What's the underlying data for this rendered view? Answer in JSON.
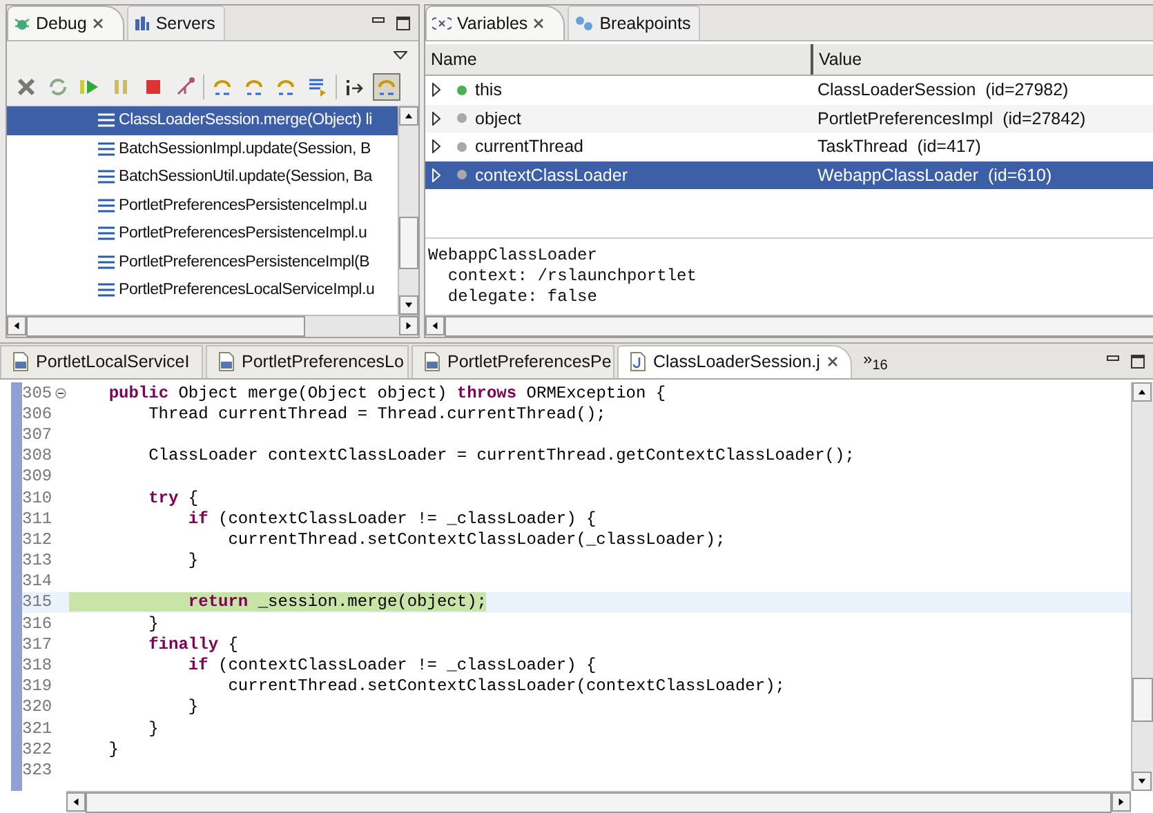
{
  "debug_view": {
    "tabs": [
      {
        "label": "Debug",
        "selected": true,
        "closable": true
      },
      {
        "label": "Servers",
        "selected": false,
        "closable": false
      }
    ],
    "toolbar": [
      {
        "kind": "remove",
        "pressed": false
      },
      {
        "kind": "relaunch",
        "pressed": false
      },
      {
        "kind": "resume",
        "pressed": false
      },
      {
        "kind": "suspend",
        "pressed": false
      },
      {
        "kind": "terminate",
        "pressed": false
      },
      {
        "kind": "disconnect",
        "pressed": false
      },
      {
        "kind": "separator"
      },
      {
        "kind": "step-into",
        "pressed": false
      },
      {
        "kind": "step-over",
        "pressed": false
      },
      {
        "kind": "step-return",
        "pressed": false
      },
      {
        "kind": "drop-frame",
        "pressed": false
      },
      {
        "kind": "separator"
      },
      {
        "kind": "instruction",
        "pressed": false
      },
      {
        "kind": "step-filter",
        "pressed": true
      }
    ],
    "frames": [
      {
        "text": "ClassLoaderSession.merge(Object) li",
        "selected": true
      },
      {
        "text": "BatchSessionImpl.update(Session, B",
        "selected": false
      },
      {
        "text": "BatchSessionUtil.update(Session, Ba",
        "selected": false
      },
      {
        "text": "PortletPreferencesPersistenceImpl.u",
        "selected": false
      },
      {
        "text": "PortletPreferencesPersistenceImpl.u",
        "selected": false
      },
      {
        "text": "PortletPreferencesPersistenceImpl(B",
        "selected": false
      },
      {
        "text": "PortletPreferencesLocalServiceImpl.u",
        "selected": false
      }
    ]
  },
  "variables_view": {
    "tabs": [
      {
        "label": "Variables",
        "selected": true,
        "closable": true
      },
      {
        "label": "Breakpoints",
        "selected": false,
        "closable": false
      }
    ],
    "columns": [
      "Name",
      "Value"
    ],
    "rows": [
      {
        "name": "this",
        "value": "ClassLoaderSession  (id=27982)",
        "color": "#4caf50",
        "selected": false
      },
      {
        "name": "object",
        "value": "PortletPreferencesImpl  (id=27842)",
        "color": "#a8a8a8",
        "selected": false
      },
      {
        "name": "currentThread",
        "value": "TaskThread  (id=417)",
        "color": "#a8a8a8",
        "selected": false
      },
      {
        "name": "contextClassLoader",
        "value": "WebappClassLoader  (id=610)",
        "color": "#a8a8a8",
        "selected": true
      }
    ],
    "detail": [
      "WebappClassLoader",
      "  context: /rslaunchportlet",
      "  delegate: false"
    ]
  },
  "editor": {
    "tabs": [
      {
        "label": "PortletLocalServiceI",
        "selected": false,
        "closable": false
      },
      {
        "label": "PortletPreferencesLo",
        "selected": false,
        "closable": false
      },
      {
        "label": "PortletPreferencesPe",
        "selected": false,
        "closable": false
      },
      {
        "label": "ClassLoaderSession.j",
        "selected": true,
        "closable": true
      }
    ],
    "overflow": {
      "symbol": "»",
      "count": "16"
    },
    "lines": [
      {
        "number": "305",
        "text": "    **public** Object merge(Object object) **throws** ORMException {",
        "current": false,
        "fold": true
      },
      {
        "number": "306",
        "text": "        Thread currentThread = Thread.currentThread();",
        "current": false,
        "fold": false
      },
      {
        "number": "307",
        "current": false,
        "fold": false
      },
      {
        "number": "308",
        "text": "        ClassLoader contextClassLoader = currentThread.getContextClassLoader();",
        "current": false,
        "fold": false
      },
      {
        "number": "309",
        "current": false,
        "fold": false
      },
      {
        "number": "310",
        "text": "        **try** {",
        "current": false,
        "fold": false
      },
      {
        "number": "311",
        "text": "            **if** (contextClassLoader != _classLoader) {",
        "current": false,
        "fold": false
      },
      {
        "number": "312",
        "text": "                currentThread.setContextClassLoader(_classLoader);",
        "current": false,
        "fold": false
      },
      {
        "number": "313",
        "text": "            }",
        "current": false,
        "fold": false
      },
      {
        "number": "314",
        "current": false,
        "fold": false
      },
      {
        "number": "315",
        "text": "            **return** _session.merge(object);",
        "current": true,
        "fold": false
      },
      {
        "number": "316",
        "text": "        }",
        "current": false,
        "fold": false
      },
      {
        "number": "317",
        "text": "        **finally** {",
        "current": false,
        "fold": false
      },
      {
        "number": "318",
        "text": "            **if** (contextClassLoader != _classLoader) {",
        "current": false,
        "fold": false
      },
      {
        "number": "319",
        "text": "                currentThread.setContextClassLoader(contextClassLoader);",
        "current": false,
        "fold": false
      },
      {
        "number": "320",
        "text": "            }",
        "current": false,
        "fold": false
      },
      {
        "number": "321",
        "text": "        }",
        "current": false,
        "fold": false
      },
      {
        "number": "322",
        "text": "    }",
        "current": false,
        "fold": false
      },
      {
        "number": "323",
        "current": false,
        "fold": false
      }
    ]
  }
}
